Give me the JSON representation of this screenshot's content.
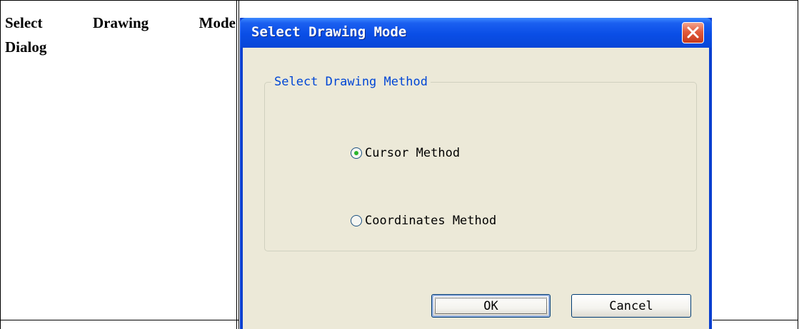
{
  "doc": {
    "label_line1_words": [
      "Select",
      "Drawing",
      "Mode"
    ],
    "label_line2": "Dialog"
  },
  "dialog": {
    "title": "Select Drawing Mode",
    "close_icon": "close-x-icon",
    "group_title": "Select Drawing Method",
    "options": [
      {
        "label": "Cursor Method",
        "selected": true
      },
      {
        "label": "Coordinates Method",
        "selected": false
      }
    ],
    "ok_label": "OK",
    "cancel_label": "Cancel"
  },
  "colors": {
    "titlebar": "#0a4ee6",
    "client": "#ece9d8",
    "group_title": "#0046d5",
    "close_button": "#e25a3c"
  }
}
